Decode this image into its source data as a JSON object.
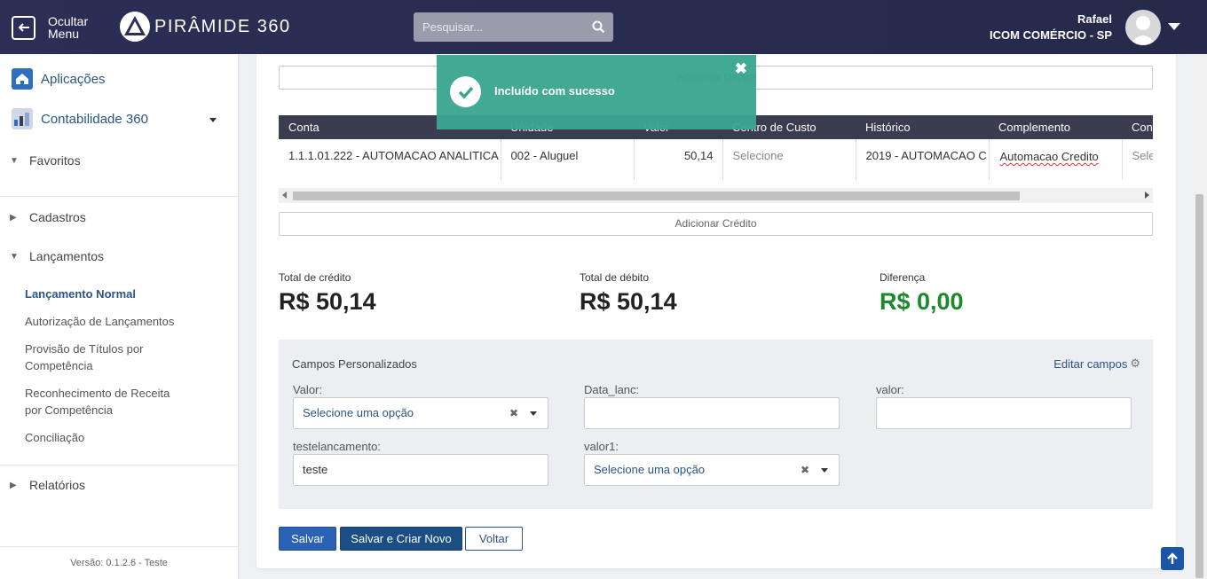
{
  "header": {
    "menu_label_line1": "Ocultar",
    "menu_label_line2": "Menu",
    "logo_text": "PIRÂMIDE 360",
    "search_placeholder": "Pesquisar...",
    "user_name": "Rafael",
    "company": "ICOM COMÉRCIO - SP"
  },
  "sidebar": {
    "apps": [
      {
        "label": "Aplicações",
        "icon": "home-icon"
      },
      {
        "label": "Contabilidade 360",
        "icon": "accounting-icon"
      }
    ],
    "groups": {
      "favoritos": "Favoritos",
      "cadastros": "Cadastros",
      "lancamentos": "Lançamentos",
      "relatorios": "Relatórios"
    },
    "links": [
      "Lançamento Normal",
      "Autorização de Lançamentos",
      "Provisão de Títulos por Competência",
      "Reconhecimento de Receita por Competência",
      "Conciliação"
    ],
    "version": "Versão: 0.1.2.6 - Teste"
  },
  "main": {
    "add_debit_label": "Adicionar Débito",
    "table": {
      "headers": [
        "Conta",
        "Unidade",
        "Valor",
        "Centro de Custo",
        "Histórico",
        "Complemento",
        "Con"
      ],
      "row": {
        "conta": "1.1.1.01.222 - AUTOMACAO ANALITICA",
        "unidade": "002 - Aluguel",
        "valor": "50,14",
        "centro_custo": "Selecione",
        "historico": "2019 - AUTOMACAO C",
        "complemento": "Automacao Credito",
        "con": "Sele"
      }
    },
    "add_credit_label": "Adicionar Crédito",
    "totals": {
      "credit_label": "Total de crédito",
      "credit_value": "R$ 50,14",
      "debit_label": "Total de débito",
      "debit_value": "R$ 50,14",
      "diff_label": "Diferença",
      "diff_value": "R$ 0,00"
    },
    "custom_fields": {
      "title": "Campos Personalizados",
      "edit_label": "Editar campos",
      "valor_label": "Valor:",
      "valor_value": "Selecione uma opção",
      "data_lanc_label": "Data_lanc:",
      "data_lanc_value": "",
      "valor_lower_label": "valor:",
      "valor_lower_value": "",
      "testelancamento_label": "testelancamento:",
      "testelancamento_value": "teste",
      "valor1_label": "valor1:",
      "valor1_value": "Selecione uma opção"
    },
    "buttons": {
      "save": "Salvar",
      "save_new": "Salvar e Criar Novo",
      "back": "Voltar"
    }
  },
  "toast": {
    "message": "Incluído com sucesso",
    "color": "#3aa591"
  }
}
